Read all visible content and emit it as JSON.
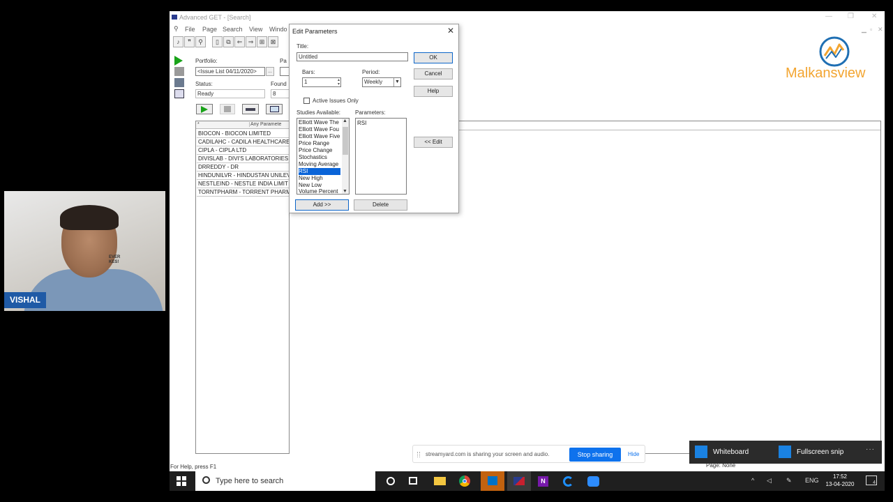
{
  "presenter": {
    "name": "VISHAL",
    "sign_text": "EVER\nKES!"
  },
  "app": {
    "title": "Advanced GET - [Search]",
    "menus": [
      "File",
      "Page",
      "Search",
      "View",
      "Windo"
    ],
    "portfolio_label": "Portfolio:",
    "portfolio_value": "<Issue List 04/11/2020>",
    "status_label": "Status:",
    "status_value": "Ready",
    "found_label": "Found",
    "found_value": "8",
    "p_label": "Pa",
    "list_header": "Any Paramete",
    "list_marker": "*",
    "issues": [
      "BIOCON - BIOCON LIMITED",
      "CADILAHC - CADILA HEALTHCARE",
      "CIPLA - CIPLA LTD",
      "DIVISLAB - DIVI'S LABORATORIES",
      "DRREDDY - DR",
      "HINDUNILVR - HINDUSTAN UNILEV",
      "NESTLEIND - NESTLE INDIA LIMIT",
      "TORNTPHARM - TORRENT PHARM"
    ],
    "statusbar_text": "For Help, press F1",
    "page_none": "Page: None"
  },
  "logo": {
    "text": "Malkansview",
    "color": "#f3a531",
    "mark_color": "#1f6fb3"
  },
  "dialog": {
    "title": "Edit Parameters",
    "title_label": "Title:",
    "title_value": "Untitled",
    "bars_label": "Bars:",
    "bars_value": "1",
    "period_label": "Period:",
    "period_value": "Weekly",
    "active_issues_label": "Active Issues Only",
    "studies_label": "Studies Available:",
    "parameters_label": "Parameters:",
    "studies": [
      "Elliott Wave The",
      "Elliott Wave Fou",
      "Elliott Wave Five",
      "Price Range",
      "Price Change",
      "Stochastics",
      "Moving Average",
      "RSI",
      "New High",
      "New Low",
      "Volume Percent"
    ],
    "selected_study": "RSI",
    "parameters": [
      "RSI"
    ],
    "ok_label": "OK",
    "cancel_label": "Cancel",
    "help_label": "Help",
    "edit_label": "<< Edit",
    "add_label": "Add >>",
    "delete_label": "Delete"
  },
  "share_banner": {
    "message": "streamyard.com is sharing your screen and audio.",
    "stop_label": "Stop sharing",
    "hide_label": "Hide"
  },
  "snip": {
    "whiteboard_label": "Whiteboard",
    "fullscreen_label": "Fullscreen snip",
    "more": "···"
  },
  "taskbar": {
    "search_placeholder": "Type here to search",
    "lang": "ENG",
    "time": "17:52",
    "date": "13-04-2020",
    "notif_count": "4"
  }
}
